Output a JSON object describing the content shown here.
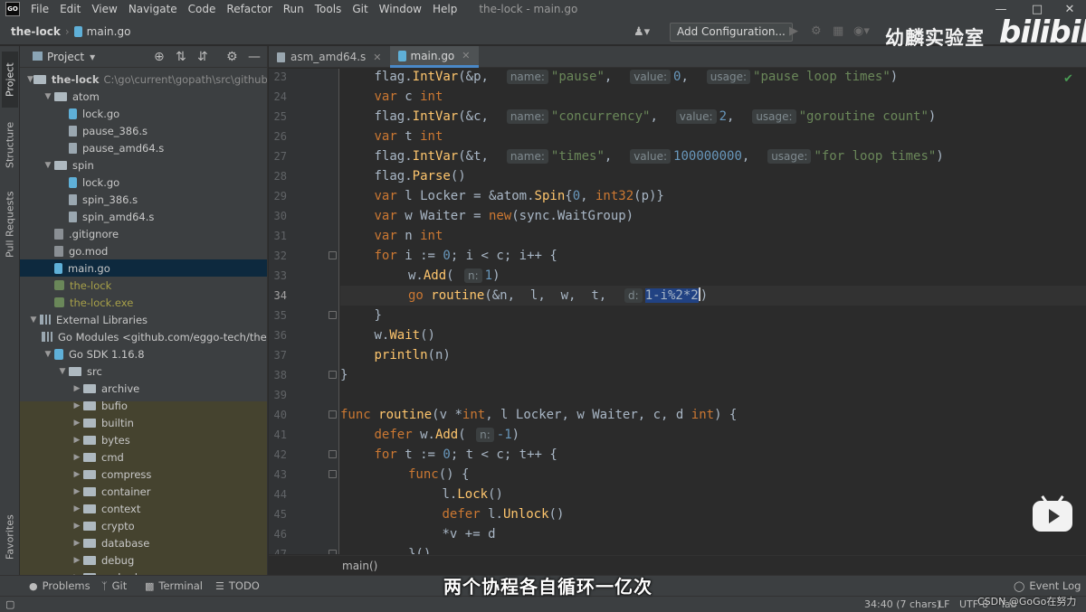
{
  "window": {
    "title": "the-lock - main.go",
    "menu": [
      "File",
      "Edit",
      "View",
      "Navigate",
      "Code",
      "Refactor",
      "Run",
      "Tools",
      "Git",
      "Window",
      "Help"
    ],
    "logo_text": "GO"
  },
  "navbar": {
    "project": "the-lock",
    "file": "main.go",
    "add_configuration": "Add Configuration..."
  },
  "overlay": {
    "channel_watermark": "幼麟实验室",
    "bilibili_logo": "bilibili",
    "subtitle": "两个协程各自循环一亿次",
    "csdn_watermark": "CSDN @GoGo在努力"
  },
  "left_stripe": {
    "project": "Project",
    "structure": "Structure",
    "pull_requests": "Pull Requests",
    "favorites": "Favorites"
  },
  "project_panel": {
    "title": "Project",
    "tree": [
      {
        "label": "the-lock",
        "path": "C:\\go\\current\\gopath\\src\\github.co",
        "depth": 0,
        "arrow": "down",
        "icon": "folder"
      },
      {
        "label": "atom",
        "depth": 1,
        "arrow": "down",
        "icon": "folder"
      },
      {
        "label": "lock.go",
        "depth": 2,
        "arrow": "none",
        "icon": "gofile"
      },
      {
        "label": "pause_386.s",
        "depth": 2,
        "arrow": "none",
        "icon": "asm"
      },
      {
        "label": "pause_amd64.s",
        "depth": 2,
        "arrow": "none",
        "icon": "asm"
      },
      {
        "label": "spin",
        "depth": 1,
        "arrow": "down",
        "icon": "folder"
      },
      {
        "label": "lock.go",
        "depth": 2,
        "arrow": "none",
        "icon": "gofile"
      },
      {
        "label": "spin_386.s",
        "depth": 2,
        "arrow": "none",
        "icon": "asm"
      },
      {
        "label": "spin_amd64.s",
        "depth": 2,
        "arrow": "none",
        "icon": "asm"
      },
      {
        "label": ".gitignore",
        "depth": 1,
        "arrow": "none",
        "icon": "mod"
      },
      {
        "label": "go.mod",
        "depth": 1,
        "arrow": "none",
        "icon": "mod"
      },
      {
        "label": "main.go",
        "depth": 1,
        "arrow": "none",
        "icon": "gofile",
        "selected": true
      },
      {
        "label": "the-lock",
        "depth": 1,
        "arrow": "none",
        "icon": "exe",
        "excluded": true
      },
      {
        "label": "the-lock.exe",
        "depth": 1,
        "arrow": "none",
        "icon": "exe",
        "excluded": true
      },
      {
        "label": "External Libraries",
        "depth": 0,
        "arrow": "down",
        "icon": "lib"
      },
      {
        "label": "Go Modules <github.com/eggo-tech/the-l",
        "depth": 1,
        "arrow": "none",
        "icon": "lib"
      },
      {
        "label": "Go SDK 1.16.8",
        "depth": 1,
        "arrow": "down",
        "icon": "sdk"
      },
      {
        "label": "src",
        "depth": 2,
        "arrow": "down",
        "icon": "folder"
      },
      {
        "label": "archive",
        "depth": 3,
        "arrow": "right",
        "icon": "folder"
      },
      {
        "label": "bufio",
        "depth": 3,
        "arrow": "right",
        "icon": "folder"
      },
      {
        "label": "builtin",
        "depth": 3,
        "arrow": "right",
        "icon": "folder"
      },
      {
        "label": "bytes",
        "depth": 3,
        "arrow": "right",
        "icon": "folder"
      },
      {
        "label": "cmd",
        "depth": 3,
        "arrow": "right",
        "icon": "folder"
      },
      {
        "label": "compress",
        "depth": 3,
        "arrow": "right",
        "icon": "folder"
      },
      {
        "label": "container",
        "depth": 3,
        "arrow": "right",
        "icon": "folder"
      },
      {
        "label": "context",
        "depth": 3,
        "arrow": "right",
        "icon": "folder"
      },
      {
        "label": "crypto",
        "depth": 3,
        "arrow": "right",
        "icon": "folder"
      },
      {
        "label": "database",
        "depth": 3,
        "arrow": "right",
        "icon": "folder"
      },
      {
        "label": "debug",
        "depth": 3,
        "arrow": "right",
        "icon": "folder"
      },
      {
        "label": "embed",
        "depth": 3,
        "arrow": "right",
        "icon": "folder"
      }
    ]
  },
  "editor": {
    "tabs": [
      {
        "label": "asm_amd64.s",
        "active": false
      },
      {
        "label": "main.go",
        "active": true
      }
    ],
    "current_line": 34,
    "lines": [
      {
        "n": "23",
        "fold": false,
        "segs": [
          [
            "",
            "\t"
          ],
          [
            "pkg",
            "flag"
          ],
          [
            "",
            "."
          ],
          [
            "fn",
            "IntVar"
          ],
          [
            "",
            "(&"
          ],
          [
            "var",
            "p"
          ],
          [
            "",
            ",  "
          ],
          [
            "hint",
            "name:"
          ],
          [
            "str",
            "\"pause\""
          ],
          [
            "",
            ",  "
          ],
          [
            "hint",
            "value:"
          ],
          [
            "num",
            "0"
          ],
          [
            "",
            ",  "
          ],
          [
            "hint",
            "usage:"
          ],
          [
            "str",
            "\"pause loop times\""
          ],
          [
            "",
            ")"
          ]
        ]
      },
      {
        "n": "24",
        "fold": false,
        "segs": [
          [
            "",
            "\t"
          ],
          [
            "kw",
            "var"
          ],
          [
            "",
            " c "
          ],
          [
            "ty",
            "int"
          ]
        ]
      },
      {
        "n": "25",
        "fold": false,
        "segs": [
          [
            "",
            "\t"
          ],
          [
            "pkg",
            "flag"
          ],
          [
            "",
            "."
          ],
          [
            "fn",
            "IntVar"
          ],
          [
            "",
            "(&c,  "
          ],
          [
            "hint",
            "name:"
          ],
          [
            "str",
            "\"concurrency\""
          ],
          [
            "",
            ",  "
          ],
          [
            "hint",
            "value:"
          ],
          [
            "num",
            "2"
          ],
          [
            "",
            ",  "
          ],
          [
            "hint",
            "usage:"
          ],
          [
            "str",
            "\"goroutine count\""
          ],
          [
            "",
            ")"
          ]
        ]
      },
      {
        "n": "26",
        "fold": false,
        "segs": [
          [
            "",
            "\t"
          ],
          [
            "kw",
            "var"
          ],
          [
            "",
            " t "
          ],
          [
            "ty",
            "int"
          ]
        ]
      },
      {
        "n": "27",
        "fold": false,
        "segs": [
          [
            "",
            "\t"
          ],
          [
            "pkg",
            "flag"
          ],
          [
            "",
            "."
          ],
          [
            "fn",
            "IntVar"
          ],
          [
            "",
            "(&t,  "
          ],
          [
            "hint",
            "name:"
          ],
          [
            "str",
            "\"times\""
          ],
          [
            "",
            ",  "
          ],
          [
            "hint",
            "value:"
          ],
          [
            "num",
            "100000000"
          ],
          [
            "",
            ",  "
          ],
          [
            "hint",
            "usage:"
          ],
          [
            "str",
            "\"for loop times\""
          ],
          [
            "",
            ")"
          ]
        ]
      },
      {
        "n": "28",
        "fold": false,
        "segs": [
          [
            "",
            "\t"
          ],
          [
            "pkg",
            "flag"
          ],
          [
            "",
            "."
          ],
          [
            "fn",
            "Parse"
          ],
          [
            "",
            "()"
          ]
        ]
      },
      {
        "n": "29",
        "fold": false,
        "segs": [
          [
            "",
            "\t"
          ],
          [
            "kw",
            "var"
          ],
          [
            "",
            " l Locker = &"
          ],
          [
            "pkg",
            "atom"
          ],
          [
            "",
            "."
          ],
          [
            "fn",
            "Spin"
          ],
          [
            "",
            "{"
          ],
          [
            "num",
            "0"
          ],
          [
            "",
            ", "
          ],
          [
            "ty",
            "int32"
          ],
          [
            "",
            "(p)}"
          ]
        ]
      },
      {
        "n": "30",
        "fold": false,
        "segs": [
          [
            "",
            "\t"
          ],
          [
            "kw",
            "var"
          ],
          [
            "",
            " w Waiter = "
          ],
          [
            "kw",
            "new"
          ],
          [
            "",
            "(sync.WaitGroup)"
          ]
        ]
      },
      {
        "n": "31",
        "fold": false,
        "segs": [
          [
            "",
            "\t"
          ],
          [
            "kw",
            "var"
          ],
          [
            "",
            " n "
          ],
          [
            "ty",
            "int"
          ]
        ]
      },
      {
        "n": "32",
        "fold": true,
        "segs": [
          [
            "",
            "\t"
          ],
          [
            "kw",
            "for"
          ],
          [
            "",
            " i := "
          ],
          [
            "num",
            "0"
          ],
          [
            "",
            "; i < c; i++ {"
          ]
        ]
      },
      {
        "n": "33",
        "fold": false,
        "segs": [
          [
            "",
            "\t\t"
          ],
          [
            "",
            "w."
          ],
          [
            "fn",
            "Add"
          ],
          [
            "",
            "( "
          ],
          [
            "hint",
            "n:"
          ],
          [
            "num",
            "1"
          ],
          [
            "",
            ")"
          ]
        ]
      },
      {
        "n": "34",
        "fold": false,
        "bulb": true,
        "segs": [
          [
            "",
            "\t\t"
          ],
          [
            "kw",
            "go"
          ],
          [
            "",
            " "
          ],
          [
            "fn",
            "routine"
          ],
          [
            "",
            "(&n,  l,  w,  t,  "
          ],
          [
            "hint",
            "d:"
          ],
          [
            "sel",
            "1-i%2*2"
          ],
          [
            "caret",
            ""
          ],
          [
            "",
            ")"
          ]
        ]
      },
      {
        "n": "35",
        "fold": true,
        "segs": [
          [
            "",
            "\t"
          ],
          [
            "",
            "}"
          ]
        ]
      },
      {
        "n": "36",
        "fold": false,
        "segs": [
          [
            "",
            "\t"
          ],
          [
            "",
            "w."
          ],
          [
            "fn",
            "Wait"
          ],
          [
            "",
            "()"
          ]
        ]
      },
      {
        "n": "37",
        "fold": false,
        "segs": [
          [
            "",
            "\t"
          ],
          [
            "fn",
            "println"
          ],
          [
            "",
            "(n)"
          ]
        ]
      },
      {
        "n": "38",
        "fold": true,
        "segs": [
          [
            "",
            "}"
          ]
        ]
      },
      {
        "n": "39",
        "fold": false,
        "segs": [
          [
            "",
            ""
          ]
        ]
      },
      {
        "n": "40",
        "fold": true,
        "segs": [
          [
            "kw",
            "func"
          ],
          [
            "",
            " "
          ],
          [
            "fn",
            "routine"
          ],
          [
            "",
            "(v *"
          ],
          [
            "ty",
            "int"
          ],
          [
            "",
            ", l Locker, w Waiter, c, d "
          ],
          [
            "ty",
            "int"
          ],
          [
            "",
            ") {"
          ]
        ]
      },
      {
        "n": "41",
        "fold": false,
        "segs": [
          [
            "",
            "\t"
          ],
          [
            "kw",
            "defer"
          ],
          [
            "",
            " w."
          ],
          [
            "fn",
            "Add"
          ],
          [
            "",
            "( "
          ],
          [
            "hint",
            "n:"
          ],
          [
            "num",
            "-1"
          ],
          [
            "",
            ")"
          ]
        ]
      },
      {
        "n": "42",
        "fold": true,
        "segs": [
          [
            "",
            "\t"
          ],
          [
            "kw",
            "for"
          ],
          [
            "",
            " t := "
          ],
          [
            "num",
            "0"
          ],
          [
            "",
            "; t < c; t++ {"
          ]
        ]
      },
      {
        "n": "43",
        "fold": true,
        "segs": [
          [
            "",
            "\t\t"
          ],
          [
            "kw",
            "func"
          ],
          [
            "",
            "() {"
          ]
        ]
      },
      {
        "n": "44",
        "fold": false,
        "segs": [
          [
            "",
            "\t\t\t"
          ],
          [
            "",
            "l."
          ],
          [
            "fn",
            "Lock"
          ],
          [
            "",
            "()"
          ]
        ]
      },
      {
        "n": "45",
        "fold": false,
        "segs": [
          [
            "",
            "\t\t\t"
          ],
          [
            "kw",
            "defer"
          ],
          [
            "",
            " l."
          ],
          [
            "fn",
            "Unlock"
          ],
          [
            "",
            "()"
          ]
        ]
      },
      {
        "n": "46",
        "fold": false,
        "segs": [
          [
            "",
            "\t\t\t"
          ],
          [
            "",
            "*v += d"
          ]
        ]
      },
      {
        "n": "47",
        "fold": true,
        "segs": [
          [
            "",
            "\t\t"
          ],
          [
            "",
            "}()"
          ]
        ]
      }
    ],
    "breadcrumb": "main()"
  },
  "tool_windows": {
    "problems": "Problems",
    "git": "Git",
    "terminal": "Terminal",
    "todo": "TODO",
    "event_log": "Event Log"
  },
  "status": {
    "position": "34:40 (7 chars)",
    "line_ending": "LF",
    "encoding": "UTF-8",
    "tab": "Tab"
  }
}
